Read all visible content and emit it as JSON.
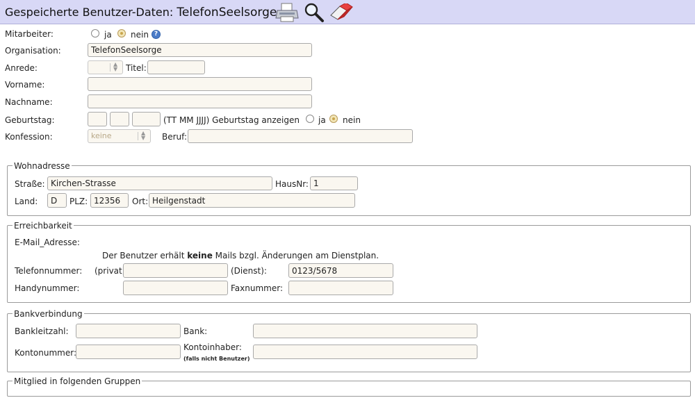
{
  "header": {
    "title_prefix": "Gespeicherte Benutzer-Daten:",
    "title_name": "TelefonSeelsorge"
  },
  "form": {
    "mitarbeiter": {
      "label": "Mitarbeiter:",
      "option_yes": "ja",
      "option_no": "nein",
      "selected": "nein",
      "help": "?"
    },
    "organisation": {
      "label": "Organisation:",
      "value": "TelefonSeelsorge"
    },
    "anrede": {
      "label": "Anrede:",
      "value": ""
    },
    "titel": {
      "label": "Titel:",
      "value": ""
    },
    "vorname": {
      "label": "Vorname:",
      "value": ""
    },
    "nachname": {
      "label": "Nachname:",
      "value": ""
    },
    "geburtstag": {
      "label": "Geburtstag:",
      "day": "",
      "month": "",
      "year": "",
      "format_hint": "(TT MM JJJJ) Geburtstag anzeigen",
      "option_yes": "ja",
      "option_no": "nein",
      "selected": "nein"
    },
    "konfession": {
      "label": "Konfession:",
      "value": "keine"
    },
    "beruf": {
      "label": "Beruf:",
      "value": ""
    }
  },
  "wohnadresse": {
    "legend": "Wohnadresse",
    "strasse_label": "Straße:",
    "strasse": "Kirchen-Strasse",
    "hausnr_label": "HausNr:",
    "hausnr": "1",
    "land_label": "Land:",
    "land": "D",
    "plz_label": "PLZ:",
    "plz": "12356",
    "ort_label": "Ort:",
    "ort": "Heilgenstadt"
  },
  "erreichbarkeit": {
    "legend": "Erreichbarkeit",
    "email_label": "E-Mail_Adresse:",
    "notice_before": "Der Benutzer erhält ",
    "notice_bold": "keine",
    "notice_after": " Mails bzgl. Änderungen am Dienstplan.",
    "telefon_label": "Telefonnummer:",
    "privat_label": "(privat)",
    "telefon_privat": "",
    "dienst_label": "(Dienst):",
    "telefon_dienst": "0123/5678",
    "handy_label": "Handynummer:",
    "handy": "",
    "fax_label": "Faxnummer:",
    "fax": ""
  },
  "bankverbindung": {
    "legend": "Bankverbindung",
    "blz_label": "Bankleitzahl:",
    "blz": "",
    "bank_label": "Bank:",
    "bank": "",
    "konto_label": "Kontonummer:",
    "konto": "",
    "inhaber_label": "Kontoinhaber:",
    "inhaber_note": "(falls nicht Benutzer)",
    "inhaber": ""
  },
  "gruppen": {
    "legend": "Mitglied in folgenden Gruppen"
  },
  "icons": {
    "print": "printer-icon",
    "search": "magnifier-icon",
    "erase": "eraser-icon"
  }
}
